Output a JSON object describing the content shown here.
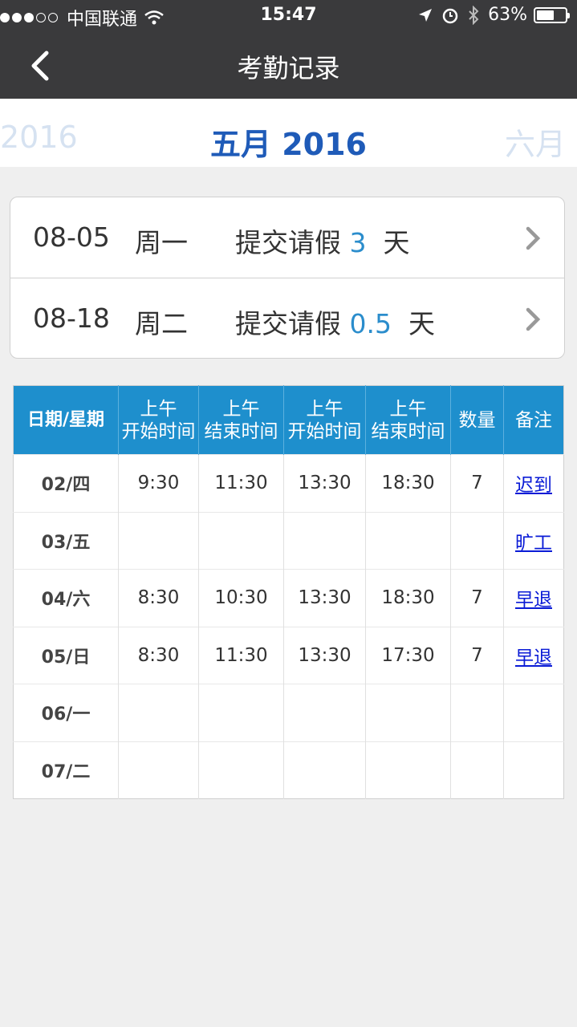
{
  "status_bar": {
    "carrier": "中国联通",
    "time": "15:47",
    "battery": "63%",
    "battery_level": 0.63
  },
  "nav": {
    "title": "考勤记录",
    "back_icon": "chevron-left-icon"
  },
  "month_selector": {
    "prev": "2016",
    "current": "五月 2016",
    "next": "六月"
  },
  "leave_records": [
    {
      "date": "08-05",
      "weekday": "周一",
      "label": "提交请假",
      "days": "3",
      "unit": "天"
    },
    {
      "date": "08-18",
      "weekday": "周二",
      "label": "提交请假",
      "days": "0.5",
      "unit": "天"
    }
  ],
  "table": {
    "headers": [
      {
        "line1": "日期/星期",
        "line2": ""
      },
      {
        "line1": "上午",
        "line2": "开始时间"
      },
      {
        "line1": "上午",
        "line2": "结束时间"
      },
      {
        "line1": "上午",
        "line2": "开始时间"
      },
      {
        "line1": "上午",
        "line2": "结束时间"
      },
      {
        "line1": "数量",
        "line2": ""
      },
      {
        "line1": "备注",
        "line2": ""
      }
    ],
    "rows": [
      {
        "date": "02/四",
        "am_start": "9:30",
        "am_end": "11:30",
        "pm_start": "13:30",
        "pm_end": "18:30",
        "count": "7",
        "note": "迟到"
      },
      {
        "date": "03/五",
        "am_start": "",
        "am_end": "",
        "pm_start": "",
        "pm_end": "",
        "count": "",
        "note": "旷工"
      },
      {
        "date": "04/六",
        "am_start": "8:30",
        "am_end": "10:30",
        "pm_start": "13:30",
        "pm_end": "18:30",
        "count": "7",
        "note": "早退"
      },
      {
        "date": "05/日",
        "am_start": "8:30",
        "am_end": "11:30",
        "pm_start": "13:30",
        "pm_end": "17:30",
        "count": "7",
        "note": "早退"
      },
      {
        "date": "06/一",
        "am_start": "",
        "am_end": "",
        "pm_start": "",
        "pm_end": "",
        "count": "",
        "note": ""
      },
      {
        "date": "07/二",
        "am_start": "",
        "am_end": "",
        "pm_start": "",
        "pm_end": "",
        "count": "",
        "note": ""
      }
    ]
  },
  "colors": {
    "header_bg": "#3a3a3c",
    "accent": "#1e8fcd",
    "month_current": "#1f5bb8",
    "link": "#0a1bd6",
    "number": "#2b8dcc"
  }
}
